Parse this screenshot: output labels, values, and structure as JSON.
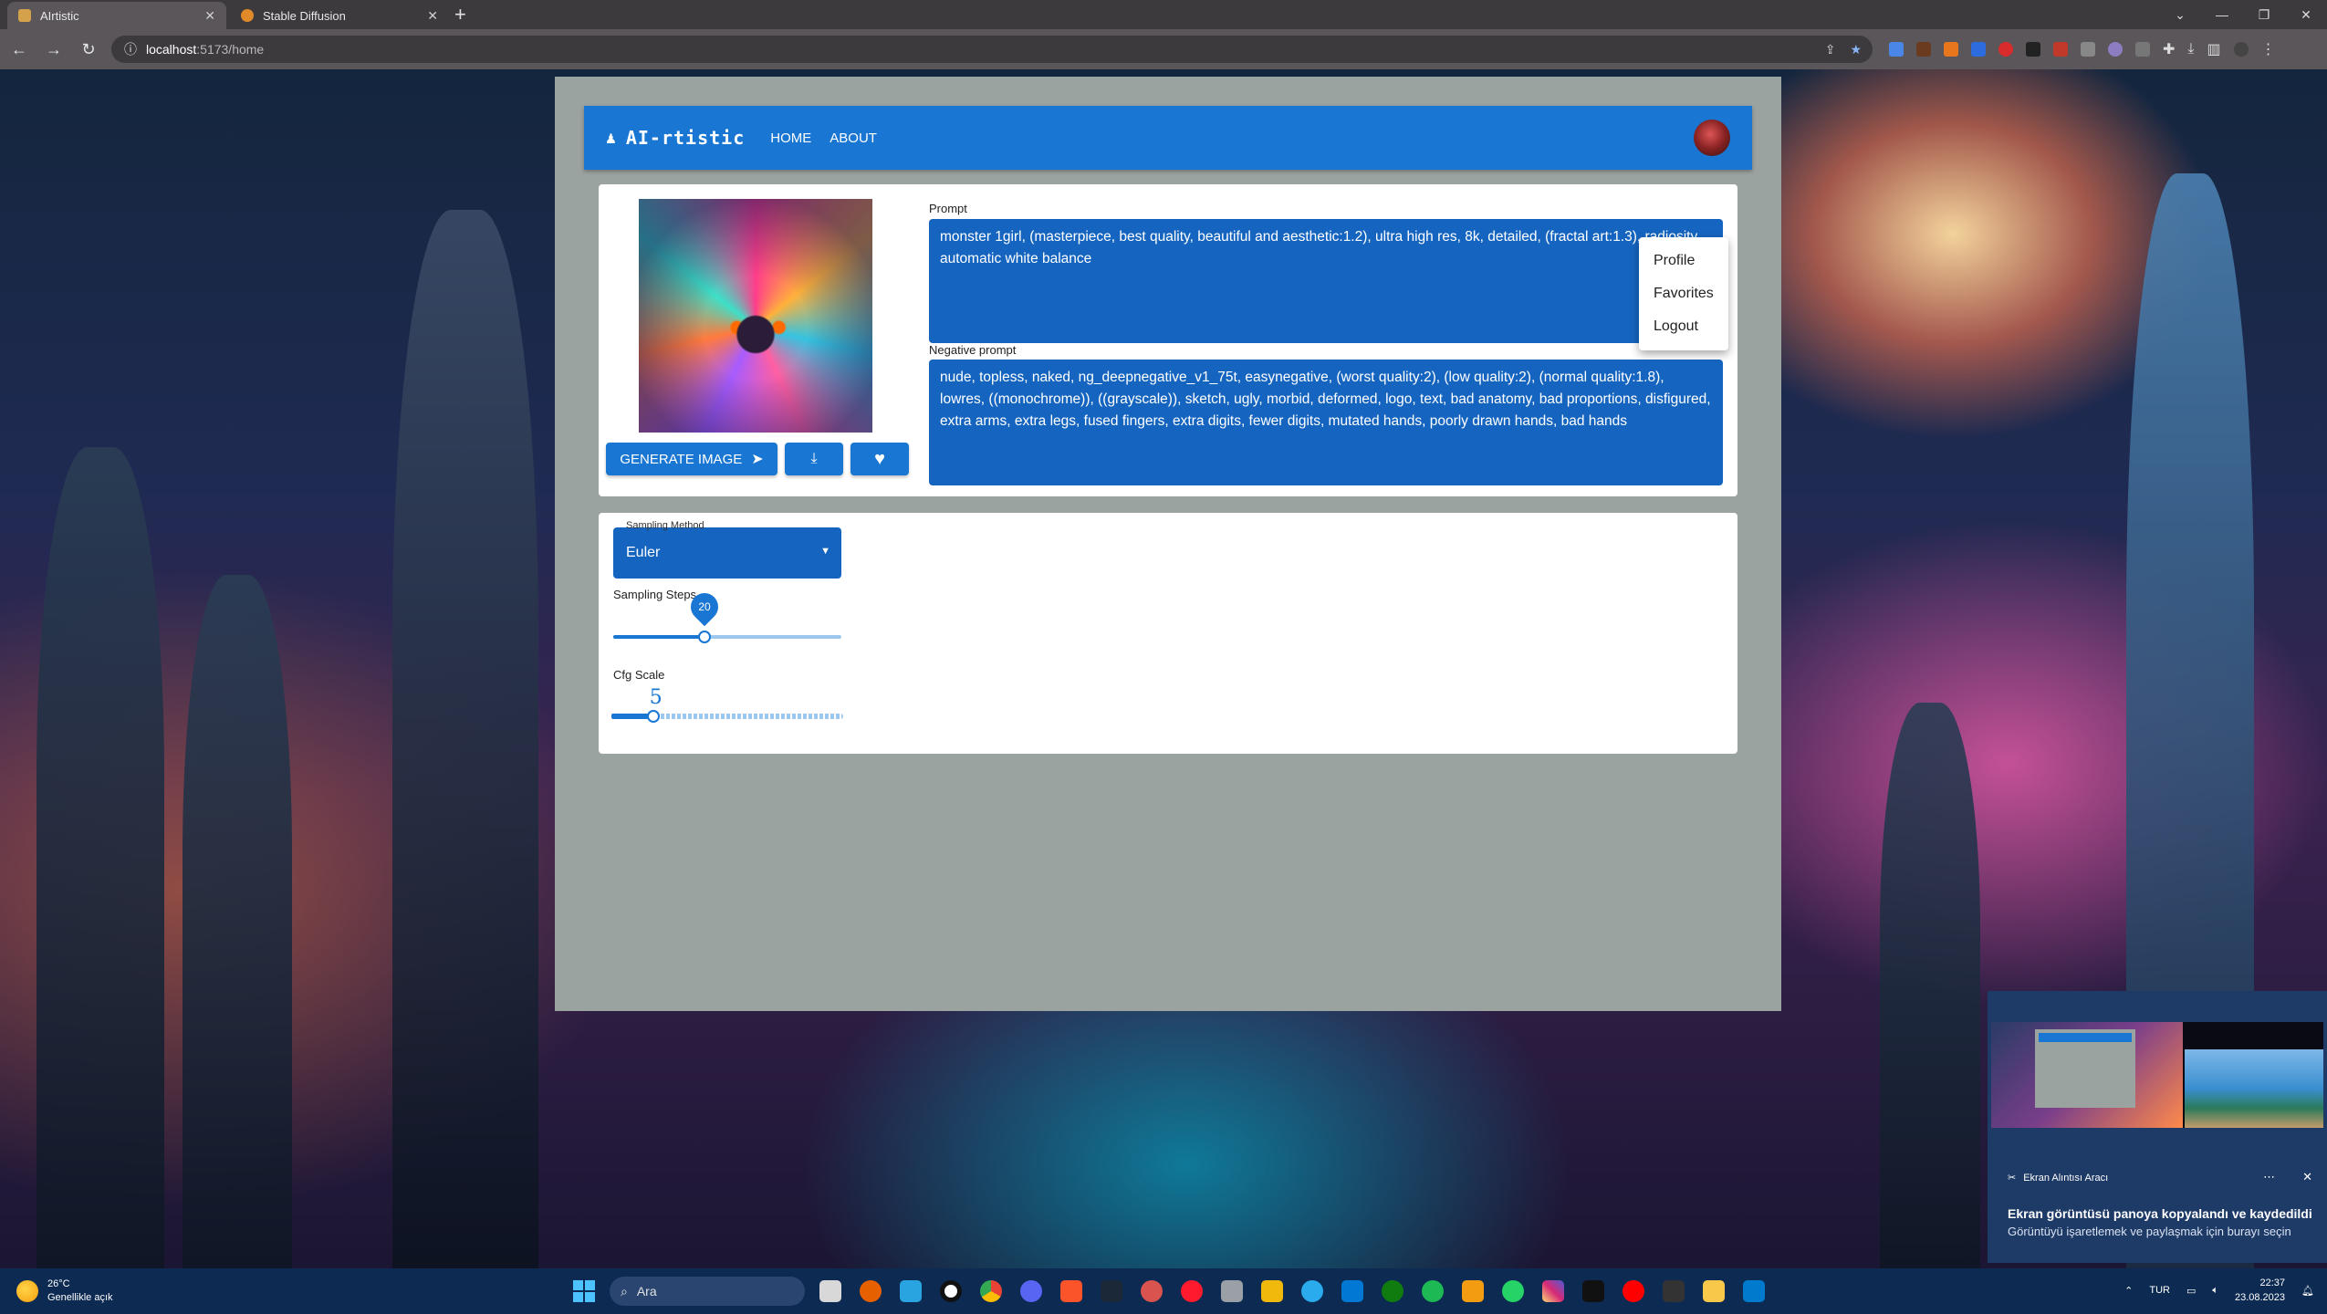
{
  "browser": {
    "tabs": [
      {
        "title": "AIrtistic",
        "active": true,
        "favicon_color": "#d4a24a"
      },
      {
        "title": "Stable Diffusion",
        "active": false,
        "favicon_color": "#e08a2a"
      }
    ],
    "url_host": "localhost",
    "url_path": ":5173/home"
  },
  "app": {
    "brand": "AI-rtistic",
    "nav": [
      "HOME",
      "ABOUT"
    ],
    "user_menu": [
      "Profile",
      "Favorites",
      "Logout"
    ],
    "generate_button": "GENERATE IMAGE",
    "prompt_label": "Prompt",
    "prompt_value": "monster 1girl, (masterpiece, best quality, beautiful and aesthetic:1.2), ultra high res, 8k, detailed, (fractal art:1.3), radiosity, automatic white balance",
    "negative_label": "Negative prompt",
    "negative_value": "nude, topless, naked, ng_deepnegative_v1_75t, easynegative, (worst quality:2), (low quality:2), (normal quality:1.8), lowres, ((monochrome)), ((grayscale)), sketch, ugly, morbid, deformed, logo, text, bad anatomy, bad proportions, disfigured, extra arms, extra legs, fused fingers, extra digits, fewer digits, mutated hands, poorly drawn hands, bad hands",
    "sampling_method_label": "Sampling Method",
    "sampling_method_value": "Euler",
    "sampling_steps_label": "Sampling Steps",
    "sampling_steps_value": "20",
    "sampling_steps_fraction": 0.4,
    "cfg_label": "Cfg Scale",
    "cfg_value": "5",
    "cfg_fraction": 0.18,
    "primary_color": "#1976d2"
  },
  "notification": {
    "app_name": "Ekran Alıntısı Aracı",
    "title": "Ekran görüntüsü panoya kopyalandı ve kaydedildi",
    "subtitle": "Görüntüyü işaretlemek ve paylaşmak için burayı seçin"
  },
  "taskbar": {
    "temperature": "26°C",
    "weather_desc": "Genellikle açık",
    "search_placeholder": "Ara",
    "language": "TUR",
    "time": "22:37",
    "date": "23.08.2023"
  }
}
